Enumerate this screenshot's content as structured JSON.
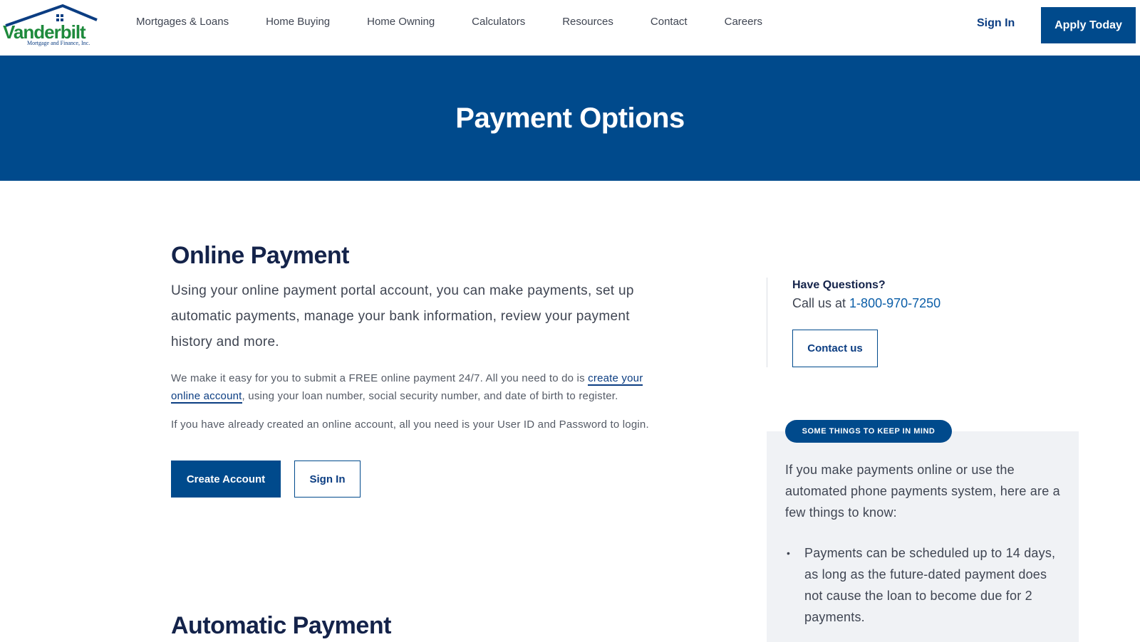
{
  "header": {
    "logo_text": "Vanderbilt",
    "logo_subtext": "Mortgage and Finance, Inc.",
    "nav": [
      {
        "label": "Mortgages & Loans"
      },
      {
        "label": "Home Buying"
      },
      {
        "label": "Home Owning"
      },
      {
        "label": "Calculators"
      },
      {
        "label": "Resources"
      },
      {
        "label": "Contact"
      },
      {
        "label": "Careers"
      }
    ],
    "sign_in": "Sign In",
    "apply": "Apply Today"
  },
  "hero": {
    "title": "Payment Options"
  },
  "online": {
    "title": "Online Payment",
    "lead": "Using your online payment portal account, you can make payments, set up automatic payments, manage your bank information, review your payment history and more.",
    "p1_start": "We make it easy for you to submit a FREE online payment 24/7. All you need to do is",
    "p1_link": "create your online account",
    "p1_end": ", using your loan number, social security number, and date of birth to register.",
    "p2": "If you have already created an online account, all you need is your User ID and Password to login.",
    "create_button": "Create Account",
    "signin_button": "Sign In"
  },
  "automatic": {
    "title": "Automatic Payment"
  },
  "sidebar": {
    "questions_title": "Have Questions?",
    "call_prefix": "Call us at ",
    "phone": "1-800-970-7250",
    "contact_button": "Contact us",
    "badge": "SOME THINGS TO KEEP IN MIND",
    "intro": "If you make payments online or use the automated phone payments system, here are a few things to know:",
    "items": [
      {
        "text": "Payments can be scheduled up to 14 days, as long as the future-dated payment does not cause the loan to become due for 2 payments."
      }
    ]
  },
  "colors": {
    "brand_blue": "#004a8c",
    "logo_green": "#1e8a3c",
    "heading_navy": "#14234a"
  }
}
